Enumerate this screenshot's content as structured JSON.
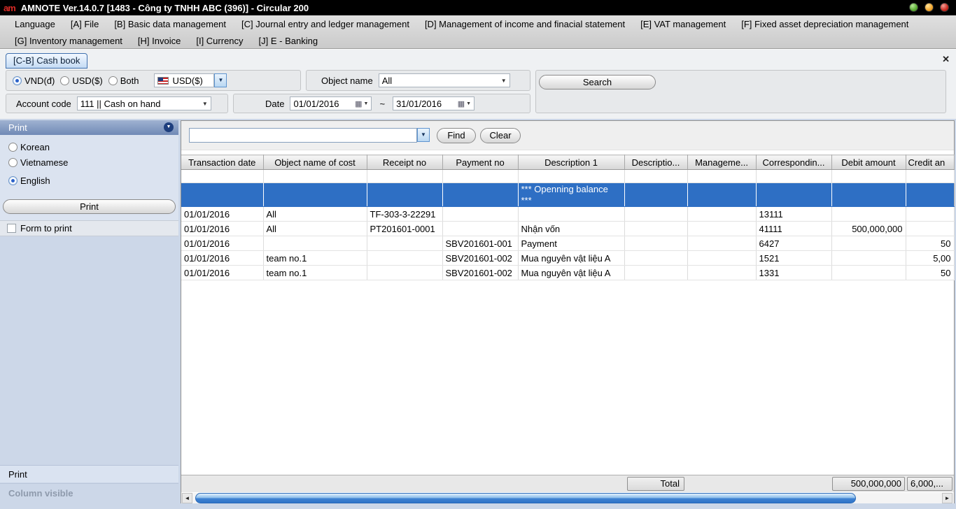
{
  "colors": {
    "accent_row": "#2e6fc4",
    "titlebar": "#000000",
    "panel_header": "#7089b6",
    "scroll_thumb": "#3f82d2"
  },
  "icons": {
    "close": "✕",
    "dropdown": "▼",
    "calendar": "▦",
    "scroll_left": "◄",
    "scroll_right": "►",
    "collapse": "▼"
  },
  "titlebar": {
    "logo": "am",
    "title": "AMNOTE Ver.14.0.7 [1483 - Công ty TNHH ABC (396)] - Circular 200"
  },
  "menu": {
    "row1": [
      "Language",
      "[A] File",
      "[B] Basic data management",
      "[C] Journal entry and ledger management",
      "[D] Management of income and finacial statement",
      "[E] VAT management",
      "[F] Fixed asset depreciation management"
    ],
    "row2": [
      "[G] Inventory management",
      "[H] Invoice",
      "[I] Currency",
      "[J] E - Banking"
    ]
  },
  "tab": {
    "label": "[C-B] Cash book"
  },
  "filters": {
    "currency_radios": [
      {
        "label": "VND(đ)",
        "selected": true
      },
      {
        "label": "USD($)",
        "selected": false
      },
      {
        "label": "Both",
        "selected": false
      }
    ],
    "currency_select_value": "USD($)",
    "object_name_label": "Object name",
    "object_name_value": "All",
    "search_label": "Search",
    "account_code_label": "Account code",
    "account_code_value": "111 || Cash on hand",
    "date_label": "Date",
    "date_from": "01/01/2016",
    "date_separator": "~",
    "date_to": "31/01/2016"
  },
  "sidebar": {
    "print_title": "Print",
    "languages": [
      {
        "label": "Korean",
        "selected": false
      },
      {
        "label": "Vietnamese",
        "selected": false
      },
      {
        "label": "English",
        "selected": true
      }
    ],
    "print_button": "Print",
    "form_to_print": "Form to print",
    "bottom": [
      "Print",
      "Column visible"
    ]
  },
  "grid": {
    "find_value": "",
    "find_button": "Find",
    "clear_button": "Clear",
    "columns": [
      "Transaction date",
      "Object name of cost",
      "Receipt no",
      "Payment no",
      "Description 1",
      "Descriptio...",
      "Manageme...",
      "Correspondin...",
      "Debit amount",
      "Credit an"
    ],
    "opening_balance": "*** Openning balance ***",
    "rows": [
      {
        "date": "01/01/2016",
        "object": "All",
        "receipt": "TF-303-3-22291",
        "payment": "",
        "desc1": "",
        "desc2": "",
        "mgmt": "",
        "corr": "13111",
        "debit": "",
        "credit": ""
      },
      {
        "date": "01/01/2016",
        "object": "All",
        "receipt": "PT201601-0001",
        "payment": "",
        "desc1": "Nhận vốn",
        "desc2": "",
        "mgmt": "",
        "corr": "41111",
        "debit": "500,000,000",
        "credit": ""
      },
      {
        "date": "01/01/2016",
        "object": "",
        "receipt": "",
        "payment": "SBV201601-001",
        "desc1": "Payment",
        "desc2": "",
        "mgmt": "",
        "corr": "6427",
        "debit": "",
        "credit": "50"
      },
      {
        "date": "01/01/2016",
        "object": "team no.1",
        "receipt": "",
        "payment": "SBV201601-002",
        "desc1": "Mua nguyên vật liệu A",
        "desc2": "",
        "mgmt": "",
        "corr": "1521",
        "debit": "",
        "credit": "5,00"
      },
      {
        "date": "01/01/2016",
        "object": "team no.1",
        "receipt": "",
        "payment": "SBV201601-002",
        "desc1": "Mua nguyên vật liệu A",
        "desc2": "",
        "mgmt": "",
        "corr": "1331",
        "debit": "",
        "credit": "50"
      }
    ],
    "total_label": "Total",
    "total_debit": "500,000,000",
    "total_credit": "6,000,..."
  }
}
